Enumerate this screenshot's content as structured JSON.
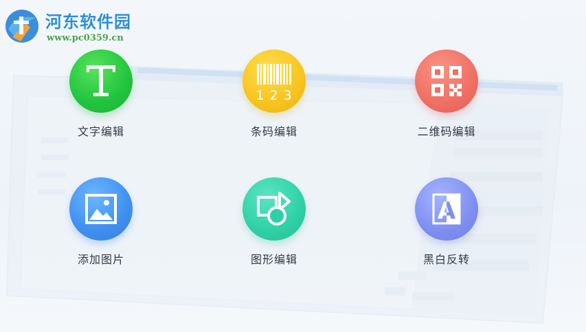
{
  "watermark": {
    "title": "河东软件园",
    "url": "www.pc0359.cn"
  },
  "features": [
    {
      "label": "文字编辑",
      "icon": "text-t-icon",
      "color": "#21c43e"
    },
    {
      "label": "条码编辑",
      "icon": "barcode-icon",
      "color": "#f7c41f",
      "barcode_digits": "1 2 3"
    },
    {
      "label": "二维码编辑",
      "icon": "qrcode-icon",
      "color": "#ef6f63"
    },
    {
      "label": "添加图片",
      "icon": "image-icon",
      "color": "#3f8ff0"
    },
    {
      "label": "图形编辑",
      "icon": "shapes-icon",
      "color": "#2fd0a6"
    },
    {
      "label": "黑白反转",
      "icon": "invert-a-icon",
      "color": "#7f8ff0",
      "letter": "A"
    }
  ]
}
